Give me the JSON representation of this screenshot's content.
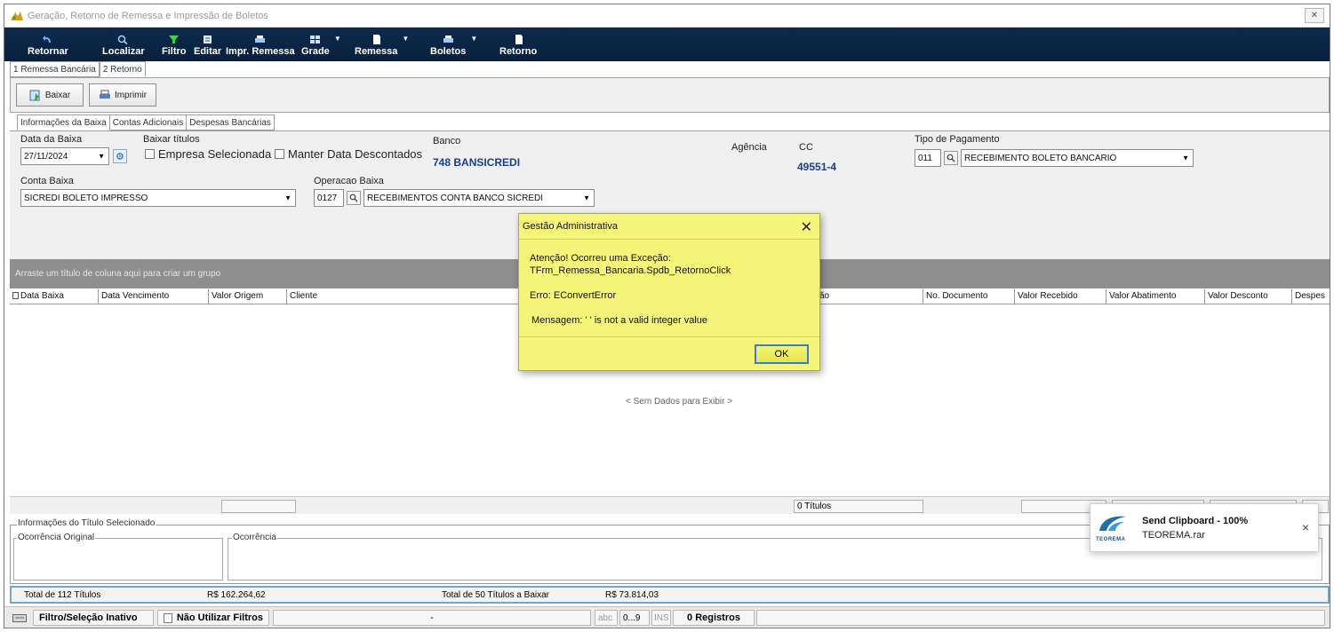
{
  "window": {
    "title": "Geração, Retorno de Remessa e Impressão de Boletos",
    "close_glyph": "✕"
  },
  "toolbar": {
    "items": [
      {
        "label": "Retornar",
        "icon": "return-arrow-icon"
      },
      {
        "label": "Localizar",
        "icon": "search-icon"
      },
      {
        "label": "Filtro",
        "icon": "filter-icon"
      },
      {
        "label": "Editar",
        "icon": "edit-icon"
      },
      {
        "label": "Impr. Remessa",
        "icon": "printer-icon"
      },
      {
        "label": "Grade",
        "icon": "grid-icon"
      },
      {
        "label": "Remessa",
        "icon": "document-icon"
      },
      {
        "label": "Boletos",
        "icon": "printer-icon"
      },
      {
        "label": "Retorno",
        "icon": "document-icon"
      }
    ]
  },
  "main_tabs": [
    "1 Remessa Bancária",
    "2 Retorno"
  ],
  "actions": {
    "baixar": "Baixar",
    "imprimir": "Imprimir"
  },
  "sub_tabs": [
    "Informações da Baixa",
    "Contas Adicionais",
    "Despesas Bancárias"
  ],
  "form": {
    "data_baixa_label": "Data da Baixa",
    "data_baixa_value": "27/11/2024",
    "baixar_titulos_label": "Baixar títulos",
    "empresa_selecionada": "Empresa Selecionada",
    "manter_data": "Manter Data Descontados",
    "banco_label": "Banco",
    "banco_value": "748 BANSICREDI",
    "agencia_label": "Agência",
    "cc_label": "CC",
    "cc_value": "49551-4",
    "tipo_pagamento_label": "Tipo de Pagamento",
    "tipo_pagamento_code": "011",
    "tipo_pagamento_value": "RECEBIMENTO BOLETO BANCARIO",
    "conta_baixa_label": "Conta Baixa",
    "conta_baixa_value": "SICREDI BOLETO IMPRESSO",
    "operacao_label": "Operacao Baixa",
    "operacao_code": "0127",
    "operacao_value": "RECEBIMENTOS CONTA BANCO SICREDI"
  },
  "grid": {
    "group_hint": "Arraste um título de coluna aqui para criar um grupo",
    "columns": [
      "Data Baixa",
      "Data Vencimento",
      "Valor Origem",
      "Cliente",
      "ão",
      "No. Documento",
      "Valor Recebido",
      "Valor Abatimento",
      "Valor Desconto",
      "Despes"
    ],
    "empty_text": "< Sem Dados para Exibir >",
    "footer_count": "0 Títulos"
  },
  "details": {
    "group_title": "Informações do Título Selecionado",
    "ocorrencia_original": "Ocorrência Original",
    "ocorrencia": "Ocorrência"
  },
  "totals": {
    "total_label": "Total de 112  Títulos",
    "total_value": "R$ 162.264,62",
    "baixar_label": "Total de 50  Títulos a Baixar",
    "baixar_value": "R$ 73.814,03"
  },
  "statusbar": {
    "filtro": "Filtro/Seleção Inativo",
    "nao_utilizar": "Não Utilizar Filtros",
    "dash": "-",
    "abc": "abc",
    "digits": "0...9",
    "ins": "INS",
    "registros": "0 Registros"
  },
  "dialog": {
    "title": "Gestão Administrativa",
    "line1": "Atenção! Ocorreu uma Exceção:",
    "line2": "TFrm_Remessa_Bancaria.Spdb_RetornoClick",
    "line3": "Erro: EConvertError",
    "line4": "Mensagem: '  ' is not a valid integer value",
    "ok": "OK",
    "close_glyph": "✕"
  },
  "toast": {
    "title": "Send Clipboard - 100%",
    "file": "TEOREMA.rar",
    "logo_text": "TEOREMA",
    "close_glyph": "×"
  },
  "colors": {
    "toolbar": "#0d2a4d",
    "dialog": "#f5f57a",
    "accent_blue": "#1a3d8f",
    "border_blue": "#6ea6d6"
  }
}
